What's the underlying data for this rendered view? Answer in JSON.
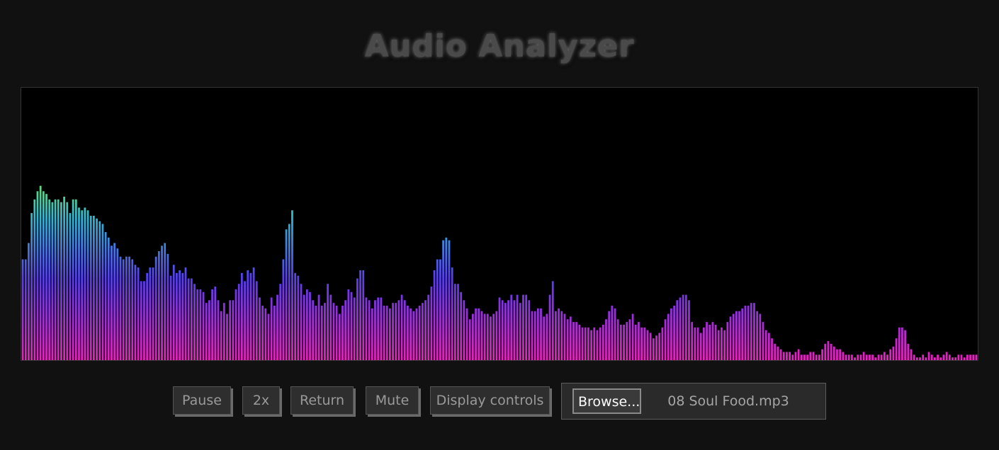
{
  "app": {
    "title": "Audio Analyzer"
  },
  "controls": {
    "pause_label": "Pause",
    "speed_label": "2x",
    "return_label": "Return",
    "mute_label": "Mute",
    "display_controls_label": "Display controls"
  },
  "file": {
    "browse_label": "Browse...",
    "file_name": "08 Soul Food.mp3"
  },
  "colors": {
    "background": "#111111",
    "analyzer_background": "#000000",
    "gradient_top": "#6fe06a",
    "gradient_mid_upper": "#2ab6d8",
    "gradient_mid": "#5a3cf0",
    "gradient_bottom": "#ee1fc6"
  },
  "spectrum": {
    "level_max": 1.0,
    "levels": [
      0.37,
      0.37,
      0.43,
      0.54,
      0.59,
      0.62,
      0.64,
      0.62,
      0.61,
      0.59,
      0.58,
      0.59,
      0.59,
      0.58,
      0.6,
      0.58,
      0.54,
      0.59,
      0.59,
      0.56,
      0.55,
      0.56,
      0.55,
      0.53,
      0.53,
      0.52,
      0.51,
      0.5,
      0.47,
      0.45,
      0.42,
      0.43,
      0.41,
      0.38,
      0.37,
      0.38,
      0.38,
      0.37,
      0.35,
      0.34,
      0.29,
      0.29,
      0.32,
      0.34,
      0.34,
      0.38,
      0.4,
      0.42,
      0.43,
      0.39,
      0.31,
      0.35,
      0.32,
      0.33,
      0.32,
      0.34,
      0.3,
      0.3,
      0.28,
      0.26,
      0.26,
      0.25,
      0.21,
      0.22,
      0.26,
      0.27,
      0.22,
      0.18,
      0.21,
      0.17,
      0.22,
      0.22,
      0.26,
      0.28,
      0.32,
      0.29,
      0.33,
      0.32,
      0.34,
      0.29,
      0.23,
      0.2,
      0.19,
      0.17,
      0.23,
      0.2,
      0.24,
      0.28,
      0.37,
      0.48,
      0.5,
      0.55,
      0.32,
      0.31,
      0.28,
      0.24,
      0.26,
      0.25,
      0.22,
      0.2,
      0.24,
      0.2,
      0.21,
      0.28,
      0.24,
      0.21,
      0.2,
      0.17,
      0.2,
      0.22,
      0.26,
      0.25,
      0.23,
      0.3,
      0.33,
      0.33,
      0.23,
      0.22,
      0.19,
      0.22,
      0.23,
      0.23,
      0.2,
      0.2,
      0.19,
      0.21,
      0.21,
      0.22,
      0.24,
      0.22,
      0.2,
      0.19,
      0.18,
      0.19,
      0.2,
      0.21,
      0.22,
      0.24,
      0.27,
      0.33,
      0.37,
      0.37,
      0.44,
      0.45,
      0.44,
      0.34,
      0.28,
      0.28,
      0.25,
      0.22,
      0.19,
      0.15,
      0.17,
      0.19,
      0.19,
      0.18,
      0.17,
      0.17,
      0.16,
      0.17,
      0.18,
      0.23,
      0.22,
      0.21,
      0.22,
      0.24,
      0.22,
      0.24,
      0.21,
      0.24,
      0.24,
      0.22,
      0.18,
      0.18,
      0.19,
      0.19,
      0.16,
      0.17,
      0.24,
      0.29,
      0.18,
      0.19,
      0.18,
      0.17,
      0.15,
      0.16,
      0.14,
      0.14,
      0.13,
      0.12,
      0.12,
      0.12,
      0.11,
      0.12,
      0.11,
      0.12,
      0.13,
      0.15,
      0.18,
      0.2,
      0.19,
      0.15,
      0.13,
      0.13,
      0.14,
      0.15,
      0.17,
      0.13,
      0.14,
      0.12,
      0.12,
      0.11,
      0.1,
      0.08,
      0.09,
      0.1,
      0.12,
      0.15,
      0.17,
      0.19,
      0.2,
      0.22,
      0.23,
      0.24,
      0.24,
      0.22,
      0.14,
      0.12,
      0.12,
      0.1,
      0.12,
      0.14,
      0.13,
      0.14,
      0.13,
      0.11,
      0.12,
      0.11,
      0.14,
      0.16,
      0.17,
      0.18,
      0.18,
      0.19,
      0.2,
      0.2,
      0.21,
      0.21,
      0.18,
      0.17,
      0.14,
      0.11,
      0.1,
      0.08,
      0.06,
      0.05,
      0.04,
      0.03,
      0.03,
      0.03,
      0.02,
      0.03,
      0.04,
      0.02,
      0.02,
      0.02,
      0.03,
      0.03,
      0.02,
      0.02,
      0.04,
      0.06,
      0.07,
      0.06,
      0.05,
      0.04,
      0.04,
      0.03,
      0.02,
      0.02,
      0.02,
      0.01,
      0.02,
      0.02,
      0.03,
      0.02,
      0.02,
      0.02,
      0.01,
      0.02,
      0.02,
      0.03,
      0.02,
      0.04,
      0.05,
      0.08,
      0.12,
      0.12,
      0.11,
      0.06,
      0.04,
      0.02,
      0.01,
      0.01,
      0.02,
      0.01,
      0.03,
      0.02,
      0.01,
      0.02,
      0.01,
      0.02,
      0.03,
      0.02,
      0.01,
      0.01,
      0.02,
      0.02,
      0.01,
      0.02,
      0.02,
      0.02,
      0.02
    ]
  }
}
